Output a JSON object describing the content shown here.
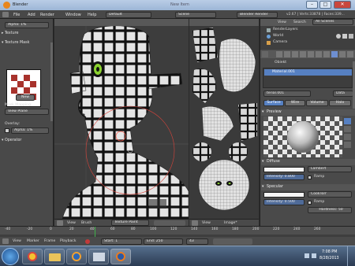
{
  "window": {
    "title": "Blender",
    "title_right": "New Item"
  },
  "menubar": {
    "items": [
      "File",
      "Add",
      "Render",
      "Window",
      "Help"
    ],
    "screen": "Default",
    "scene": "Scene",
    "engine": "Blender Render",
    "stats": "v2.67 | Verts:33878 | Faces:339..."
  },
  "toolshelf": {
    "alpha": "Alpha: 1%",
    "texture": "Texture",
    "texture_mask": "Texture Mask",
    "new_button": "New",
    "mask_mapping_label": "Mask Mapping:",
    "mask_mapping_value": "View Plane",
    "overlay_label": "Overlay:",
    "overlay_alpha": "Alpha: 1%",
    "operator": "Operator"
  },
  "viewport": {
    "footer": {
      "view": "View",
      "brush": "Brush",
      "mode": "Texture Paint"
    }
  },
  "uv_editor": {
    "footer": {
      "view": "View",
      "image": "Image*"
    }
  },
  "outliner": {
    "view": "View",
    "search": "Search",
    "filter": "All Scenes",
    "items": [
      {
        "label": "RenderLayers"
      },
      {
        "label": "World"
      },
      {
        "label": "Camera"
      }
    ]
  },
  "properties": {
    "object_name": "Obiekt",
    "material_item": "Material.001",
    "material_field": "terial.001",
    "data_dropdown": "Data",
    "tabs": [
      "Surface",
      "Wire",
      "Volume",
      "Halo"
    ],
    "preview": "Preview",
    "diffuse": "Diffuse",
    "diffuse_shader": "Lambert",
    "diffuse_intensity": "Intensity: 0.800",
    "ramp": "Ramp",
    "specular": "Specular",
    "spec_shader": "CookTorr",
    "spec_intensity": "Intensity: 0.500",
    "spec_ramp": "Ramp",
    "hardness": "Hardness: 50"
  },
  "timeline": {
    "ticks": [
      "-40",
      "-20",
      "0",
      "20",
      "40",
      "60",
      "80",
      "100",
      "120",
      "140",
      "160",
      "180",
      "200",
      "220",
      "240",
      "260"
    ],
    "view": "View",
    "marker": "Marker",
    "frame": "Frame",
    "playback": "Playback",
    "start": "Start: 1",
    "end": "End: 250",
    "current": "43"
  },
  "taskbar": {
    "time": "7:08 PM",
    "date": "8/28/2013"
  },
  "colors": {
    "accent_blue": "#5680c2",
    "selected": "#6e8fd1",
    "checker": "#a8322c"
  }
}
